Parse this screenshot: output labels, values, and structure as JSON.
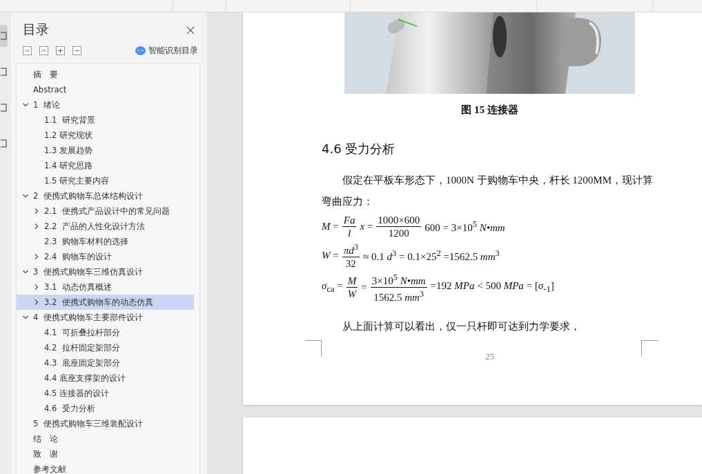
{
  "side_rail": {
    "items": [
      {
        "selected": true
      },
      {
        "selected": false
      },
      {
        "selected": false
      },
      {
        "selected": false
      }
    ]
  },
  "toc": {
    "title": "目录",
    "smart_label": "智能识别目录",
    "items": [
      {
        "label": "摘　要"
      },
      {
        "label": "Abstract"
      },
      {
        "label": "1  绪论",
        "expanded": true,
        "children": [
          {
            "label": "1.1  研究背景"
          },
          {
            "label": "1.2 研究现状"
          },
          {
            "label": "1.3 发展趋势"
          },
          {
            "label": "1.4 研究思路"
          },
          {
            "label": "1.5 研究主要内容"
          }
        ]
      },
      {
        "label": "2  便携式购物车总体结构设计",
        "expanded": true,
        "children": [
          {
            "label": "2.1  便携式产品设计中的常见问题",
            "expanded": false
          },
          {
            "label": "2.2  产品的人性化设计方法",
            "expanded": false
          },
          {
            "label": "2.3  购物车材料的选择"
          },
          {
            "label": "2.4  购物车的设计",
            "expanded": false
          }
        ]
      },
      {
        "label": "3  便携式购物车三维仿真设计",
        "expanded": true,
        "children": [
          {
            "label": "3.1  动态仿真概述",
            "expanded": false
          },
          {
            "label": "3.2  便携式购物车的动态仿真",
            "expanded": false,
            "selected": true
          }
        ]
      },
      {
        "label": "4  便携式购物车主要部件设计",
        "expanded": true,
        "children": [
          {
            "label": "4.1  可折叠拉杆部分"
          },
          {
            "label": "4.2  拉杆固定架部分"
          },
          {
            "label": "4.3  底座固定架部分"
          },
          {
            "label": "4.4 底座支撑架的设计"
          },
          {
            "label": "4.5 连接器的设计"
          },
          {
            "label": "4.6  受力分析"
          }
        ]
      },
      {
        "label": "5  便携式购物车三维装配设计"
      },
      {
        "label": "结　论"
      },
      {
        "label": "致　谢"
      },
      {
        "label": "参考文献"
      }
    ]
  },
  "document": {
    "figure": {
      "kind": "picture",
      "caption": "图 15  连接器"
    },
    "heading": "4.6  受力分析",
    "paragraph": "假定在平板车形态下，1000N 于购物车中央，杆长 1200MM，现计算弯曲应力：",
    "formulas": [
      [
        {
          "kind": "text",
          "text": "*M* ="
        },
        {
          "kind": "frac",
          "num": "*Fa*",
          "den": "*l*"
        },
        {
          "kind": "text",
          "text": "*x* ="
        },
        {
          "kind": "frac",
          "num": "1000×600",
          "den": "1200"
        },
        {
          "kind": "text",
          "text": "600 = 3×10$^{5}$ *N•mm*"
        }
      ],
      [
        {
          "kind": "text",
          "text": "*W* ="
        },
        {
          "kind": "frac",
          "num": "*πd*$^{3}$",
          "den": "32"
        },
        {
          "kind": "text",
          "text": "≈ 0.1 *d*$^{3}$ = 0.1×25$^{2}$ =1562.5 *mm*$^{3}$"
        }
      ],
      [
        {
          "kind": "text",
          "text": "*σ*$_{ca}$ ="
        },
        {
          "kind": "frac",
          "num": "*M*",
          "den": "*W*"
        },
        {
          "kind": "text",
          "text": "="
        },
        {
          "kind": "frac",
          "num": "3×10$^{5}$ *N•mm*",
          "den": "1562.5 *mm*$^{3}$"
        },
        {
          "kind": "text",
          "text": "=192 *MPa* < 500 *MPa* = [*σ*$_{-1}$]"
        }
      ]
    ],
    "conclusion": "从上面计算可以看出，仅一只杆即可达到力学要求，",
    "page_number": "25"
  }
}
